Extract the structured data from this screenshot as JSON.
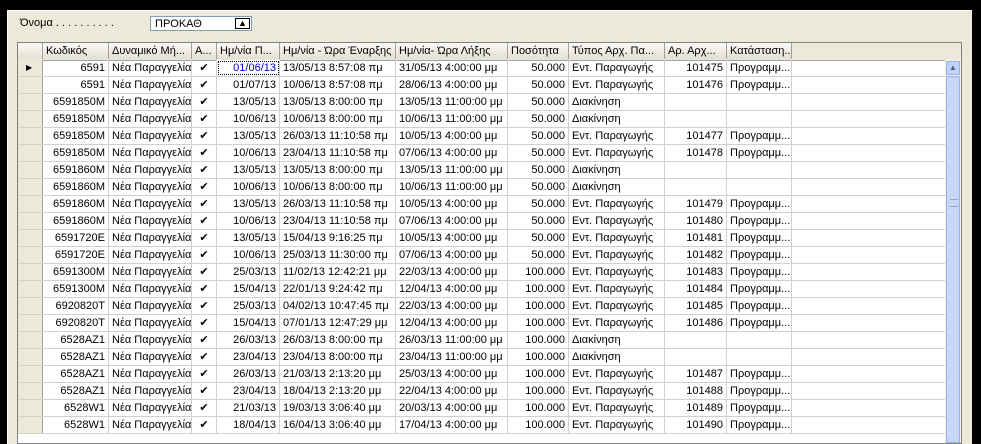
{
  "filter": {
    "label": "Όνομα . . . . . . . . . .",
    "value": "ΠΡΟΚΑΘ",
    "button_icon": "arrow-up-icon"
  },
  "grid": {
    "columns": [
      "Κωδικός",
      "Δυναμικό Μή...",
      "Α...",
      "Ημ/νία Π...",
      "Ημ/νία - Ώρα Έναρξης",
      "Ημ/νία- Ώρα Λήξης",
      "Ποσότητα",
      "Τύπος Αρχ. Πα...",
      "Αρ. Αρχ...",
      "Κατάσταση..."
    ],
    "rows": [
      {
        "code": "6591",
        "dyn": "Νέα Παραγγελία",
        "a": "✔",
        "date": "01/06/13",
        "start": "13/05/13  8:57:08 πμ",
        "end": "31/05/13  4:00:00 μμ",
        "qty": "50.000",
        "type": "Εντ. Παραγωγής",
        "num": "101475",
        "status": "Προγραμμ..."
      },
      {
        "code": "6591",
        "dyn": "Νέα Παραγγελία",
        "a": "✔",
        "date": "01/07/13",
        "start": "10/06/13  8:57:08 πμ",
        "end": "28/06/13  4:00:00 μμ",
        "qty": "50.000",
        "type": "Εντ. Παραγωγής",
        "num": "101476",
        "status": "Προγραμμ..."
      },
      {
        "code": "6591850M",
        "dyn": "Νέα Παραγγελία",
        "a": "✔",
        "date": "13/05/13",
        "start": "13/05/13  8:00:00 πμ",
        "end": "13/05/13 11:00:00 μμ",
        "qty": "50.000",
        "type": "Διακίνηση",
        "num": "",
        "status": ""
      },
      {
        "code": "6591850M",
        "dyn": "Νέα Παραγγελία",
        "a": "✔",
        "date": "10/06/13",
        "start": "10/06/13  8:00:00 πμ",
        "end": "10/06/13 11:00:00 μμ",
        "qty": "50.000",
        "type": "Διακίνηση",
        "num": "",
        "status": ""
      },
      {
        "code": "6591850M",
        "dyn": "Νέα Παραγγελία",
        "a": "✔",
        "date": "13/05/13",
        "start": "26/03/13 11:10:58 πμ",
        "end": "10/05/13  4:00:00 μμ",
        "qty": "50.000",
        "type": "Εντ. Παραγωγής",
        "num": "101477",
        "status": "Προγραμμ..."
      },
      {
        "code": "6591850M",
        "dyn": "Νέα Παραγγελία",
        "a": "✔",
        "date": "10/06/13",
        "start": "23/04/13 11:10:58 πμ",
        "end": "07/06/13  4:00:00 μμ",
        "qty": "50.000",
        "type": "Εντ. Παραγωγής",
        "num": "101478",
        "status": "Προγραμμ..."
      },
      {
        "code": "6591860M",
        "dyn": "Νέα Παραγγελία",
        "a": "✔",
        "date": "13/05/13",
        "start": "13/05/13  8:00:00 πμ",
        "end": "13/05/13 11:00:00 μμ",
        "qty": "50.000",
        "type": "Διακίνηση",
        "num": "",
        "status": ""
      },
      {
        "code": "6591860M",
        "dyn": "Νέα Παραγγελία",
        "a": "✔",
        "date": "10/06/13",
        "start": "10/06/13  8:00:00 πμ",
        "end": "10/06/13 11:00:00 μμ",
        "qty": "50.000",
        "type": "Διακίνηση",
        "num": "",
        "status": ""
      },
      {
        "code": "6591860M",
        "dyn": "Νέα Παραγγελία",
        "a": "✔",
        "date": "13/05/13",
        "start": "26/03/13 11:10:58 πμ",
        "end": "10/05/13  4:00:00 μμ",
        "qty": "50.000",
        "type": "Εντ. Παραγωγής",
        "num": "101479",
        "status": "Προγραμμ..."
      },
      {
        "code": "6591860M",
        "dyn": "Νέα Παραγγελία",
        "a": "✔",
        "date": "10/06/13",
        "start": "23/04/13 11:10:58 πμ",
        "end": "07/06/13  4:00:00 μμ",
        "qty": "50.000",
        "type": "Εντ. Παραγωγής",
        "num": "101480",
        "status": "Προγραμμ..."
      },
      {
        "code": "6591720E",
        "dyn": "Νέα Παραγγελία",
        "a": "✔",
        "date": "13/05/13",
        "start": "15/04/13  9:16:25 πμ",
        "end": "10/05/13  4:00:00 μμ",
        "qty": "50.000",
        "type": "Εντ. Παραγωγής",
        "num": "101481",
        "status": "Προγραμμ..."
      },
      {
        "code": "6591720E",
        "dyn": "Νέα Παραγγελία",
        "a": "✔",
        "date": "10/06/13",
        "start": "25/03/13 11:30:00 πμ",
        "end": "07/06/13  4:00:00 μμ",
        "qty": "50.000",
        "type": "Εντ. Παραγωγής",
        "num": "101482",
        "status": "Προγραμμ..."
      },
      {
        "code": "6591300M",
        "dyn": "Νέα Παραγγελία",
        "a": "✔",
        "date": "25/03/13",
        "start": "11/02/13 12:42:21 μμ",
        "end": "22/03/13  4:00:00 μμ",
        "qty": "100.000",
        "type": "Εντ. Παραγωγής",
        "num": "101483",
        "status": "Προγραμμ..."
      },
      {
        "code": "6591300M",
        "dyn": "Νέα Παραγγελία",
        "a": "✔",
        "date": "15/04/13",
        "start": "22/01/13  9:24:42 πμ",
        "end": "12/04/13  4:00:00 μμ",
        "qty": "100.000",
        "type": "Εντ. Παραγωγής",
        "num": "101484",
        "status": "Προγραμμ..."
      },
      {
        "code": "6920820T",
        "dyn": "Νέα Παραγγελία",
        "a": "✔",
        "date": "25/03/13",
        "start": "04/02/13 10:47:45 πμ",
        "end": "22/03/13  4:00:00 μμ",
        "qty": "100.000",
        "type": "Εντ. Παραγωγής",
        "num": "101485",
        "status": "Προγραμμ..."
      },
      {
        "code": "6920820T",
        "dyn": "Νέα Παραγγελία",
        "a": "✔",
        "date": "15/04/13",
        "start": "07/01/13 12:47:29 μμ",
        "end": "12/04/13  4:00:00 μμ",
        "qty": "100.000",
        "type": "Εντ. Παραγωγής",
        "num": "101486",
        "status": "Προγραμμ..."
      },
      {
        "code": "6528AZ1",
        "dyn": "Νέα Παραγγελία",
        "a": "✔",
        "date": "26/03/13",
        "start": "26/03/13  8:00:00 πμ",
        "end": "26/03/13 11:00:00 μμ",
        "qty": "100.000",
        "type": "Διακίνηση",
        "num": "",
        "status": ""
      },
      {
        "code": "6528AZ1",
        "dyn": "Νέα Παραγγελία",
        "a": "✔",
        "date": "23/04/13",
        "start": "23/04/13  8:00:00 πμ",
        "end": "23/04/13 11:00:00 μμ",
        "qty": "100.000",
        "type": "Διακίνηση",
        "num": "",
        "status": ""
      },
      {
        "code": "6528AZ1",
        "dyn": "Νέα Παραγγελία",
        "a": "✔",
        "date": "26/03/13",
        "start": "21/03/13  2:13:20 μμ",
        "end": "25/03/13  4:00:00 μμ",
        "qty": "100.000",
        "type": "Εντ. Παραγωγής",
        "num": "101487",
        "status": "Προγραμμ..."
      },
      {
        "code": "6528AZ1",
        "dyn": "Νέα Παραγγελία",
        "a": "✔",
        "date": "23/04/13",
        "start": "18/04/13  2:13:20 μμ",
        "end": "22/04/13  4:00:00 μμ",
        "qty": "100.000",
        "type": "Εντ. Παραγωγής",
        "num": "101488",
        "status": "Προγραμμ..."
      },
      {
        "code": "6528W1",
        "dyn": "Νέα Παραγγελία",
        "a": "✔",
        "date": "21/03/13",
        "start": "19/03/13  3:06:40 μμ",
        "end": "20/03/13  4:00:00 μμ",
        "qty": "100.000",
        "type": "Εντ. Παραγωγής",
        "num": "101489",
        "status": "Προγραμμ..."
      },
      {
        "code": "6528W1",
        "dyn": "Νέα Παραγγελία",
        "a": "✔",
        "date": "18/04/13",
        "start": "16/04/13  3:06:40 μμ",
        "end": "17/04/13  4:00:00 μμ",
        "qty": "100.000",
        "type": "Εντ. Παραγωγής",
        "num": "101490",
        "status": "Προγραμμ..."
      }
    ]
  },
  "scrollbar": {
    "up_icon": "chevron-up-icon"
  }
}
